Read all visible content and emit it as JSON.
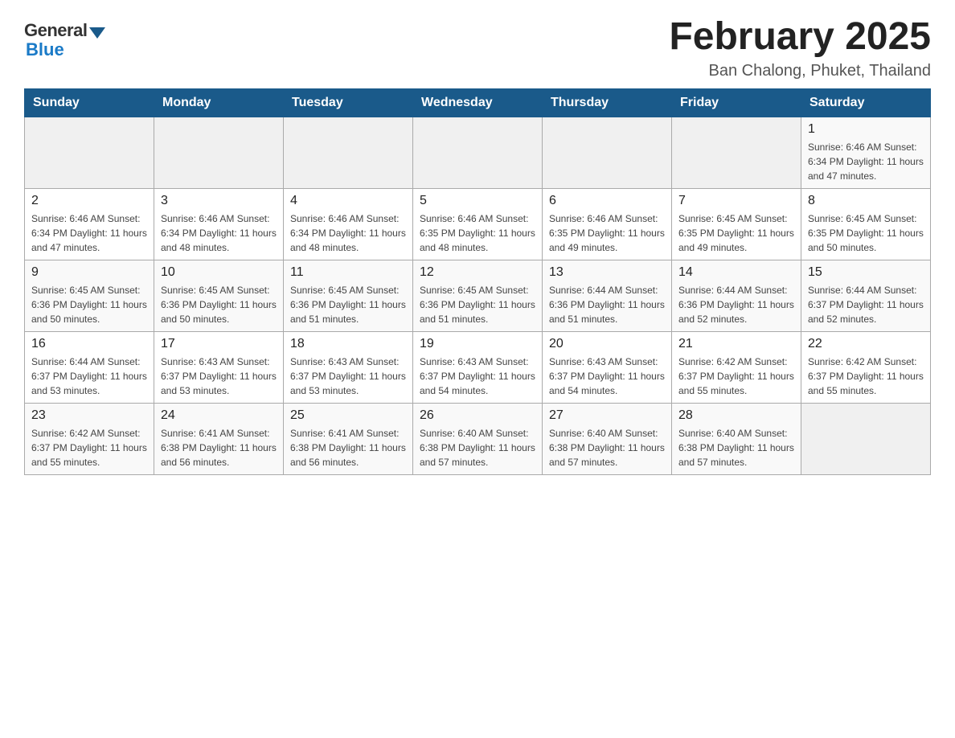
{
  "header": {
    "logo_general": "General",
    "logo_blue": "Blue",
    "title": "February 2025",
    "subtitle": "Ban Chalong, Phuket, Thailand"
  },
  "days_of_week": [
    "Sunday",
    "Monday",
    "Tuesday",
    "Wednesday",
    "Thursday",
    "Friday",
    "Saturday"
  ],
  "weeks": [
    [
      {
        "day": "",
        "info": ""
      },
      {
        "day": "",
        "info": ""
      },
      {
        "day": "",
        "info": ""
      },
      {
        "day": "",
        "info": ""
      },
      {
        "day": "",
        "info": ""
      },
      {
        "day": "",
        "info": ""
      },
      {
        "day": "1",
        "info": "Sunrise: 6:46 AM\nSunset: 6:34 PM\nDaylight: 11 hours\nand 47 minutes."
      }
    ],
    [
      {
        "day": "2",
        "info": "Sunrise: 6:46 AM\nSunset: 6:34 PM\nDaylight: 11 hours\nand 47 minutes."
      },
      {
        "day": "3",
        "info": "Sunrise: 6:46 AM\nSunset: 6:34 PM\nDaylight: 11 hours\nand 48 minutes."
      },
      {
        "day": "4",
        "info": "Sunrise: 6:46 AM\nSunset: 6:34 PM\nDaylight: 11 hours\nand 48 minutes."
      },
      {
        "day": "5",
        "info": "Sunrise: 6:46 AM\nSunset: 6:35 PM\nDaylight: 11 hours\nand 48 minutes."
      },
      {
        "day": "6",
        "info": "Sunrise: 6:46 AM\nSunset: 6:35 PM\nDaylight: 11 hours\nand 49 minutes."
      },
      {
        "day": "7",
        "info": "Sunrise: 6:45 AM\nSunset: 6:35 PM\nDaylight: 11 hours\nand 49 minutes."
      },
      {
        "day": "8",
        "info": "Sunrise: 6:45 AM\nSunset: 6:35 PM\nDaylight: 11 hours\nand 50 minutes."
      }
    ],
    [
      {
        "day": "9",
        "info": "Sunrise: 6:45 AM\nSunset: 6:36 PM\nDaylight: 11 hours\nand 50 minutes."
      },
      {
        "day": "10",
        "info": "Sunrise: 6:45 AM\nSunset: 6:36 PM\nDaylight: 11 hours\nand 50 minutes."
      },
      {
        "day": "11",
        "info": "Sunrise: 6:45 AM\nSunset: 6:36 PM\nDaylight: 11 hours\nand 51 minutes."
      },
      {
        "day": "12",
        "info": "Sunrise: 6:45 AM\nSunset: 6:36 PM\nDaylight: 11 hours\nand 51 minutes."
      },
      {
        "day": "13",
        "info": "Sunrise: 6:44 AM\nSunset: 6:36 PM\nDaylight: 11 hours\nand 51 minutes."
      },
      {
        "day": "14",
        "info": "Sunrise: 6:44 AM\nSunset: 6:36 PM\nDaylight: 11 hours\nand 52 minutes."
      },
      {
        "day": "15",
        "info": "Sunrise: 6:44 AM\nSunset: 6:37 PM\nDaylight: 11 hours\nand 52 minutes."
      }
    ],
    [
      {
        "day": "16",
        "info": "Sunrise: 6:44 AM\nSunset: 6:37 PM\nDaylight: 11 hours\nand 53 minutes."
      },
      {
        "day": "17",
        "info": "Sunrise: 6:43 AM\nSunset: 6:37 PM\nDaylight: 11 hours\nand 53 minutes."
      },
      {
        "day": "18",
        "info": "Sunrise: 6:43 AM\nSunset: 6:37 PM\nDaylight: 11 hours\nand 53 minutes."
      },
      {
        "day": "19",
        "info": "Sunrise: 6:43 AM\nSunset: 6:37 PM\nDaylight: 11 hours\nand 54 minutes."
      },
      {
        "day": "20",
        "info": "Sunrise: 6:43 AM\nSunset: 6:37 PM\nDaylight: 11 hours\nand 54 minutes."
      },
      {
        "day": "21",
        "info": "Sunrise: 6:42 AM\nSunset: 6:37 PM\nDaylight: 11 hours\nand 55 minutes."
      },
      {
        "day": "22",
        "info": "Sunrise: 6:42 AM\nSunset: 6:37 PM\nDaylight: 11 hours\nand 55 minutes."
      }
    ],
    [
      {
        "day": "23",
        "info": "Sunrise: 6:42 AM\nSunset: 6:37 PM\nDaylight: 11 hours\nand 55 minutes."
      },
      {
        "day": "24",
        "info": "Sunrise: 6:41 AM\nSunset: 6:38 PM\nDaylight: 11 hours\nand 56 minutes."
      },
      {
        "day": "25",
        "info": "Sunrise: 6:41 AM\nSunset: 6:38 PM\nDaylight: 11 hours\nand 56 minutes."
      },
      {
        "day": "26",
        "info": "Sunrise: 6:40 AM\nSunset: 6:38 PM\nDaylight: 11 hours\nand 57 minutes."
      },
      {
        "day": "27",
        "info": "Sunrise: 6:40 AM\nSunset: 6:38 PM\nDaylight: 11 hours\nand 57 minutes."
      },
      {
        "day": "28",
        "info": "Sunrise: 6:40 AM\nSunset: 6:38 PM\nDaylight: 11 hours\nand 57 minutes."
      },
      {
        "day": "",
        "info": ""
      }
    ]
  ]
}
